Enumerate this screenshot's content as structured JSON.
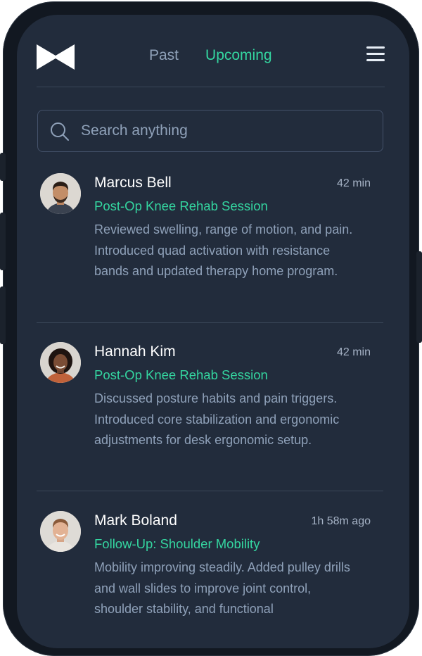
{
  "header": {
    "tabs": [
      {
        "label": "Past",
        "active": false
      },
      {
        "label": "Upcoming",
        "active": true
      }
    ]
  },
  "search": {
    "placeholder": "Search anything"
  },
  "sessions": [
    {
      "name": "Marcus Bell",
      "time": "42 min",
      "title": "Post-Op Knee Rehab Session",
      "description": "Reviewed swelling, range of motion, and pain. Introduced quad activation with resistance bands and updated therapy home program."
    },
    {
      "name": "Hannah Kim",
      "time": "42 min",
      "title": "Post-Op Knee Rehab Session",
      "description": "Discussed posture habits and pain triggers. Introduced core stabilization and ergonomic adjustments for desk ergonomic  setup."
    },
    {
      "name": "Mark Boland",
      "time": "1h 58m ago",
      "title": "Follow-Up: Shoulder Mobility",
      "description": "Mobility improving steadily. Added pulley drills and wall slides to improve joint control, shoulder stability, and functional"
    }
  ],
  "colors": {
    "background": "#222c3c",
    "accent": "#34d6a0",
    "muted_text": "#8fa1b9",
    "primary_text": "#ffffff"
  },
  "icons": {
    "logo": "bowtie-logo-icon",
    "menu": "hamburger-menu-icon",
    "search": "search-icon"
  }
}
